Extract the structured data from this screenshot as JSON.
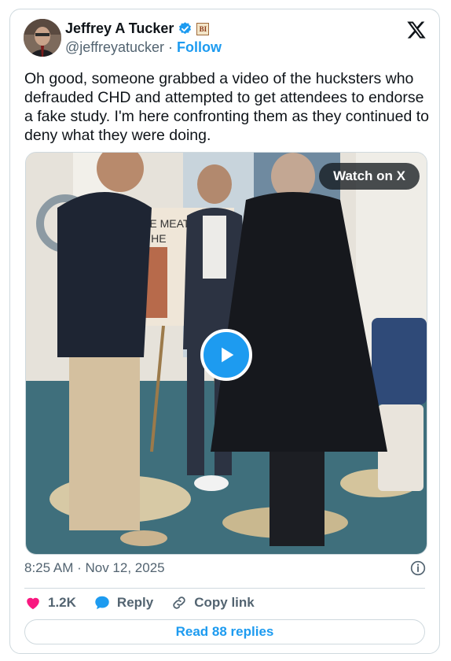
{
  "author": {
    "name": "Jeffrey A Tucker",
    "handle": "@jeffreyatucker",
    "separator": "·",
    "follow_label": "Follow",
    "affiliation_badge": "BI"
  },
  "tweet": {
    "text": "Oh good, someone grabbed a video of the hucksters who defrauded CHD and attempted to get attendees to endorse a fake study. I'm here confronting them as they continued to deny what they were doing."
  },
  "media": {
    "watch_label": "Watch on X",
    "sign_text_line1": "KE MEAT",
    "sign_text_line2": "L HE"
  },
  "meta": {
    "timestamp": "8:25 AM · Nov 12, 2025"
  },
  "actions": {
    "likes": "1.2K",
    "reply_label": "Reply",
    "copy_label": "Copy link",
    "read_replies_label": "Read 88 replies"
  },
  "colors": {
    "accent": "#1d9bf0",
    "like": "#f91880",
    "text_secondary": "#536471"
  },
  "icons": [
    "verified-badge-icon",
    "x-logo-icon",
    "play-icon",
    "info-icon",
    "heart-icon",
    "reply-bubble-icon",
    "link-icon"
  ]
}
